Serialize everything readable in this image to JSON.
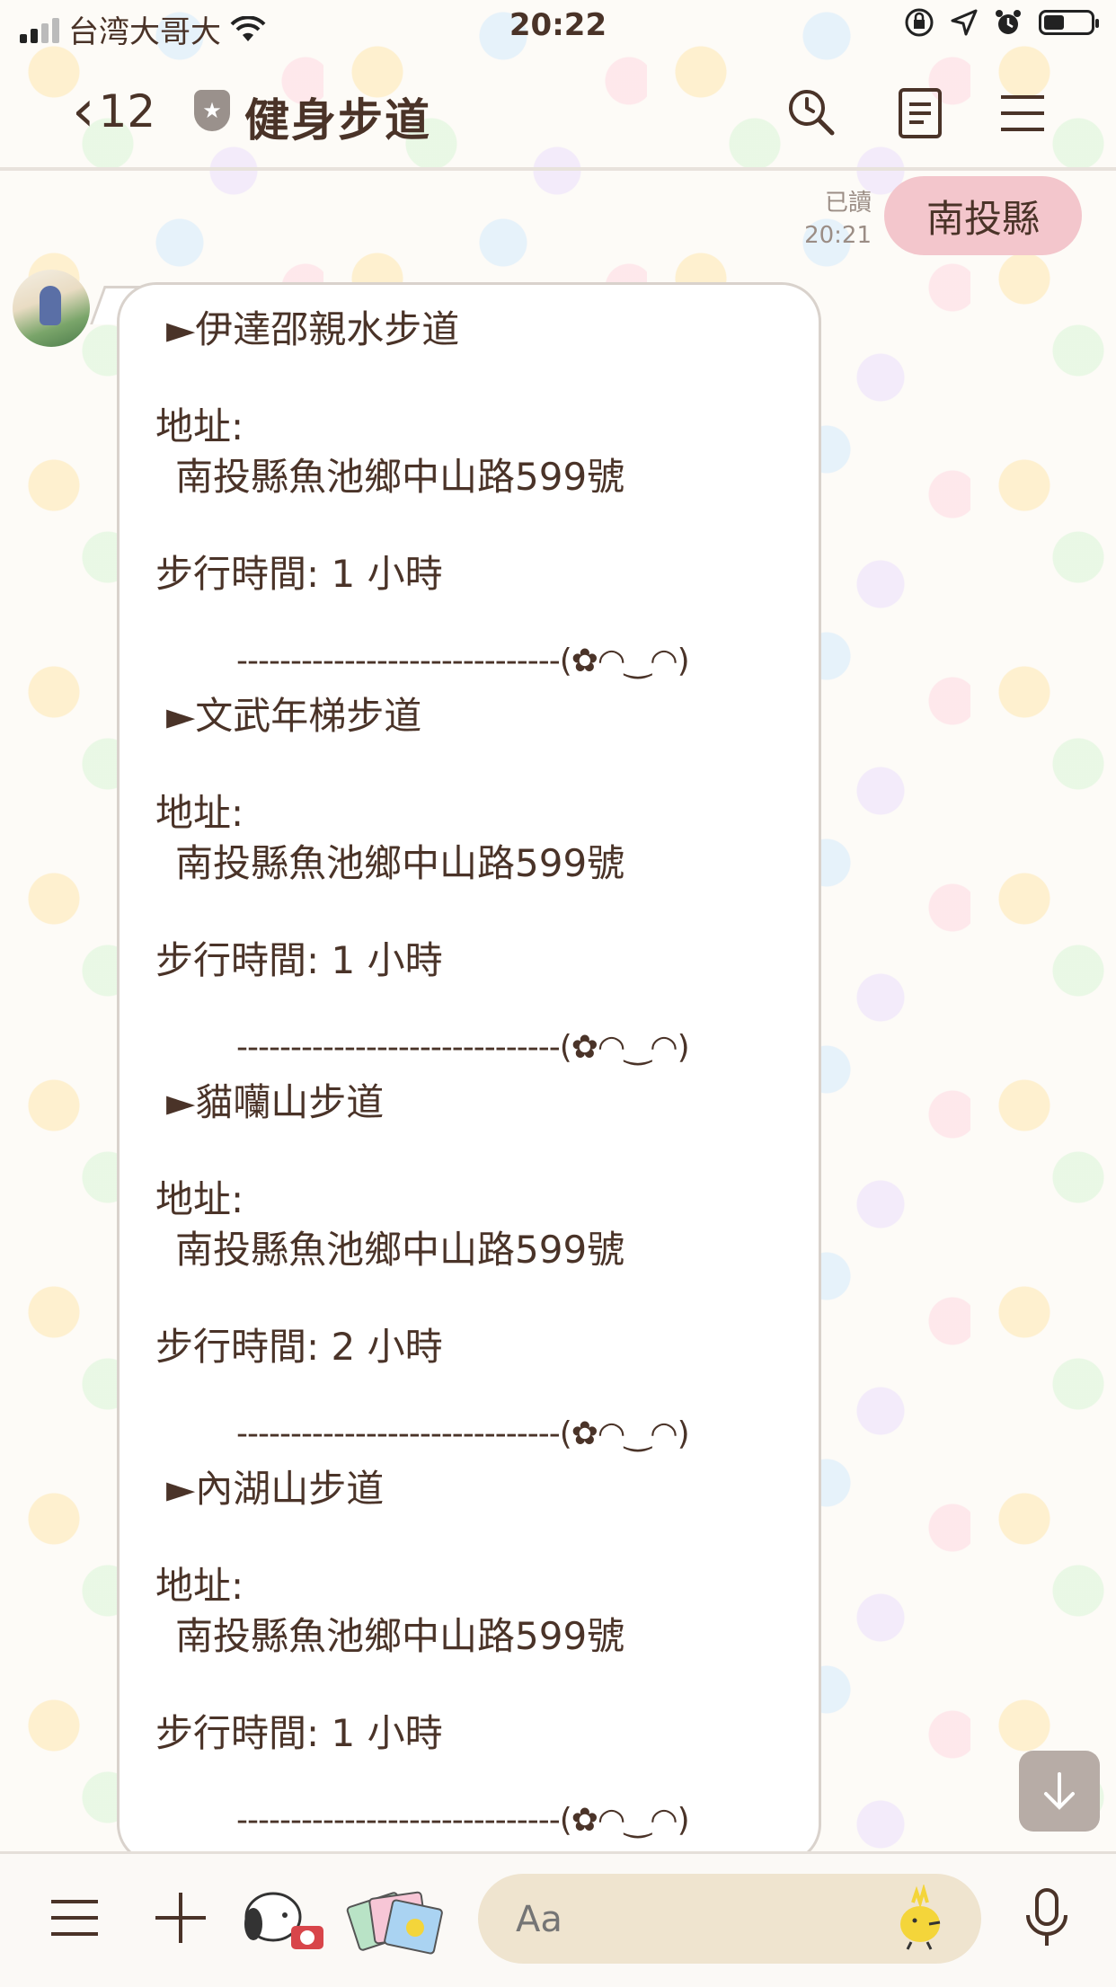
{
  "status_bar": {
    "carrier": "台湾大哥大",
    "time": "20:22"
  },
  "header": {
    "back_count": "12",
    "title": "健身步道",
    "icons": [
      "search-clock-icon",
      "notes-icon",
      "menu-icon"
    ]
  },
  "user_message": {
    "read_label": "已讀",
    "time": "20:21",
    "text": "南投縣"
  },
  "bot_message": {
    "entries": [
      {
        "name": "►伊達邵親水步道",
        "address_label": "地址:",
        "address": "南投縣魚池鄉中山路599號",
        "duration": "步行時間: 1 小時"
      },
      {
        "name": "►文武年梯步道",
        "address_label": "地址:",
        "address": "南投縣魚池鄉中山路599號",
        "duration": "步行時間: 1 小時"
      },
      {
        "name": "►貓囒山步道",
        "address_label": "地址:",
        "address": "南投縣魚池鄉中山路599號",
        "duration": "步行時間: 2 小時"
      },
      {
        "name": "►內湖山步道",
        "address_label": "地址:",
        "address": "南投縣魚池鄉中山路599號",
        "duration": "步行時間: 1 小時"
      }
    ],
    "separator": "------------------------------(✿◠‿◠)"
  },
  "input_bar": {
    "placeholder": "Aa",
    "icons": [
      "menu-icon",
      "plus-icon",
      "snoopy-camera-sticker",
      "photos-sticker",
      "woodstock-emoji-icon",
      "microphone-icon"
    ]
  },
  "colors": {
    "text": "#4a3328",
    "user_bubble": "#f3c6cc",
    "input_bg": "#efe4cf",
    "scroll_button": "#b7aca6"
  }
}
